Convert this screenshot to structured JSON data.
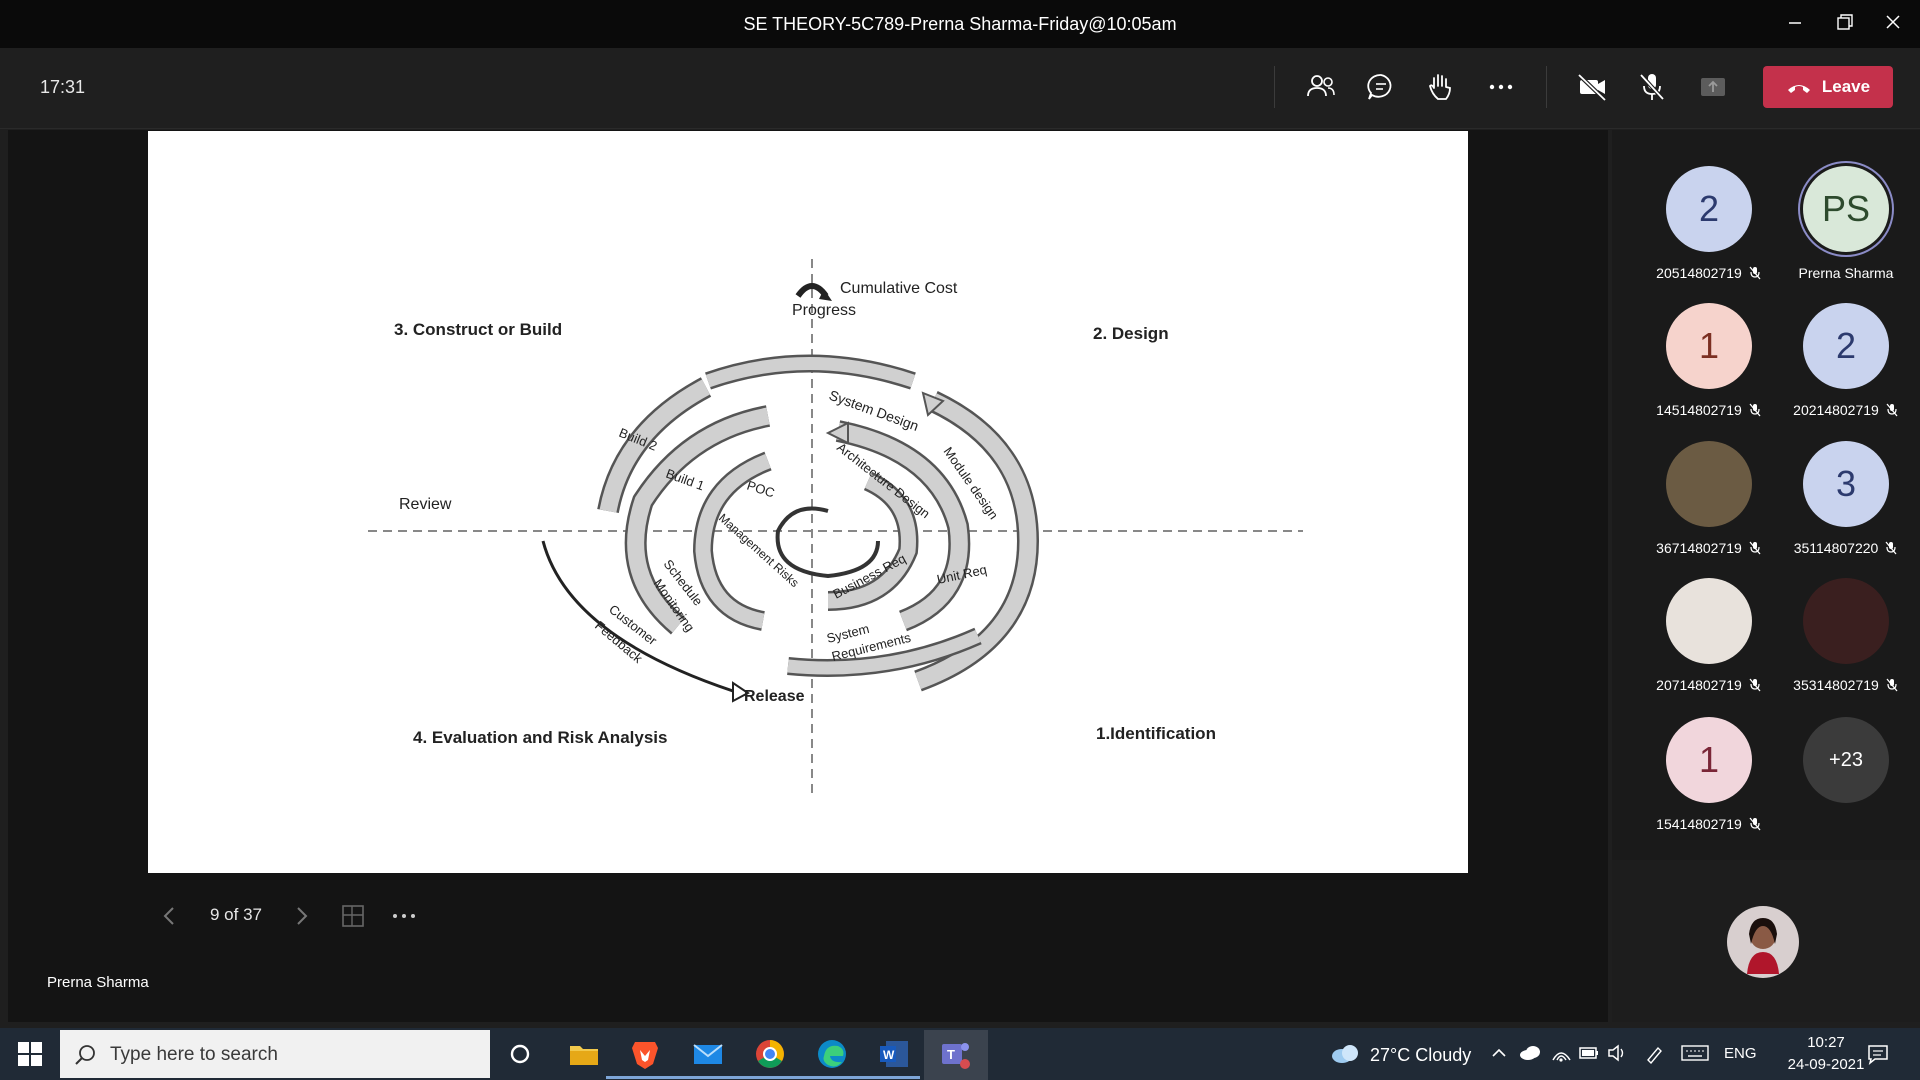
{
  "window": {
    "title": "SE THEORY-5C789-Prerna Sharma-Friday@10:05am"
  },
  "meeting": {
    "elapsed": "17:31",
    "leave_label": "Leave",
    "presenter": "Prerna Sharma",
    "page_indicator": "9 of 37"
  },
  "slide": {
    "top_label_1": "Cumulative Cost",
    "top_label_2": "Progress",
    "q3": "3. Construct or Build",
    "q2": "2. Design",
    "q4": "4. Evaluation and Risk Analysis",
    "q1": "1.Identification",
    "review": "Review",
    "release": "Release",
    "arc_labels": {
      "build2": "Build 2",
      "build1": "Build 1",
      "poc": "POC",
      "system_design": "System Design",
      "architecture": "Architecture Design",
      "module": "Module design",
      "mgmt_risks": "Management Risks",
      "schedule": "Schedule",
      "monitoring": "Monitoring",
      "customer": "Customer",
      "feedback": "Feedback",
      "business_req": "Business Req",
      "unit_req": "Unit Req",
      "system": "System",
      "requirements": "Requirements"
    }
  },
  "participants": [
    {
      "initials": "2",
      "name": "20514802719",
      "bg": "#c9d3ee",
      "fg": "#2c3a6e",
      "muted": true
    },
    {
      "initials": "PS",
      "name": "Prerna Sharma",
      "bg": "#d9e8d9",
      "fg": "#2d4a2d",
      "muted": false
    },
    {
      "initials": "1",
      "name": "14514802719",
      "bg": "#f6d3cc",
      "fg": "#7b2f22",
      "muted": true
    },
    {
      "initials": "2",
      "name": "20214802719",
      "bg": "#c9d3ee",
      "fg": "#2c3a6e",
      "muted": true
    },
    {
      "initials": "",
      "name": "36714802719",
      "bg": "#6b5b43",
      "fg": "#fff",
      "muted": true
    },
    {
      "initials": "3",
      "name": "35114807220",
      "bg": "#c9d3ee",
      "fg": "#2c3a6e",
      "muted": true
    },
    {
      "initials": "",
      "name": "20714802719",
      "bg": "#e8e2dc",
      "fg": "#fff",
      "muted": true
    },
    {
      "initials": "",
      "name": "35314802719",
      "bg": "#3a1f1f",
      "fg": "#fff",
      "muted": true
    },
    {
      "initials": "1",
      "name": "15414802719",
      "bg": "#f1d6dc",
      "fg": "#7a2637",
      "muted": true
    },
    {
      "initials": "+23",
      "name": "",
      "bg": "#3b3b3b",
      "fg": "#fff",
      "muted": false
    }
  ],
  "taskbar": {
    "search_placeholder": "Type here to search",
    "weather": "27°C  Cloudy",
    "lang": "ENG",
    "time": "10:27",
    "date": "24-09-2021"
  }
}
